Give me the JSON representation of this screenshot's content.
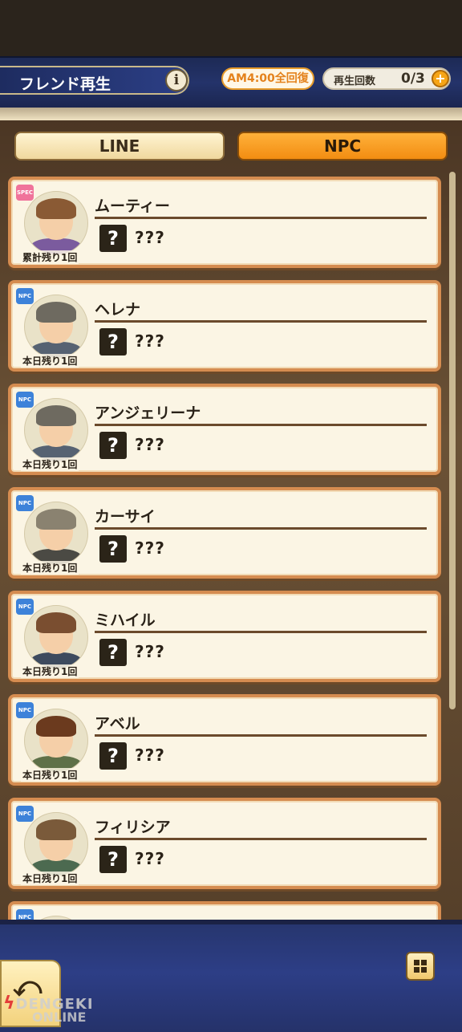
{
  "header": {
    "title": "フレンド再生",
    "info_icon": "i",
    "reset_label": "AM4:00全回復",
    "count_label": "再生回数",
    "count_value": "0/3",
    "plus_icon": "+"
  },
  "tabs": [
    {
      "label": "LINE",
      "active": false
    },
    {
      "label": "NPC",
      "active": true
    }
  ],
  "entries": [
    {
      "tag": "SPEC",
      "name": "ムーティー",
      "remaining": "累計残り1回",
      "status": "???",
      "hair": "#8a5a34",
      "body": "#7b5b9e"
    },
    {
      "tag": "NPC",
      "name": "ヘレナ",
      "remaining": "本日残り1回",
      "status": "???",
      "hair": "#6e6a60",
      "body": "#566272"
    },
    {
      "tag": "NPC",
      "name": "アンジェリーナ",
      "remaining": "本日残り1回",
      "status": "???",
      "hair": "#6e6a60",
      "body": "#566272"
    },
    {
      "tag": "NPC",
      "name": "カーサイ",
      "remaining": "本日残り1回",
      "status": "???",
      "hair": "#8a8270",
      "body": "#4b4a44"
    },
    {
      "tag": "NPC",
      "name": "ミハイル",
      "remaining": "本日残り1回",
      "status": "???",
      "hair": "#7a4e30",
      "body": "#3d4a5e"
    },
    {
      "tag": "NPC",
      "name": "アベル",
      "remaining": "本日残り1回",
      "status": "???",
      "hair": "#6b3a1e",
      "body": "#5e7048"
    },
    {
      "tag": "NPC",
      "name": "フィリシア",
      "remaining": "本日残り1回",
      "status": "???",
      "hair": "#7a5a3a",
      "body": "#4c6a50"
    },
    {
      "tag": "NPC",
      "name": "",
      "remaining": "",
      "status": "",
      "hair": "#7a5a3a",
      "body": "#566272"
    }
  ],
  "footer": {
    "back_icon": "⤺",
    "watermark": "DENGEKI",
    "watermark_sub": "ONLINE"
  }
}
